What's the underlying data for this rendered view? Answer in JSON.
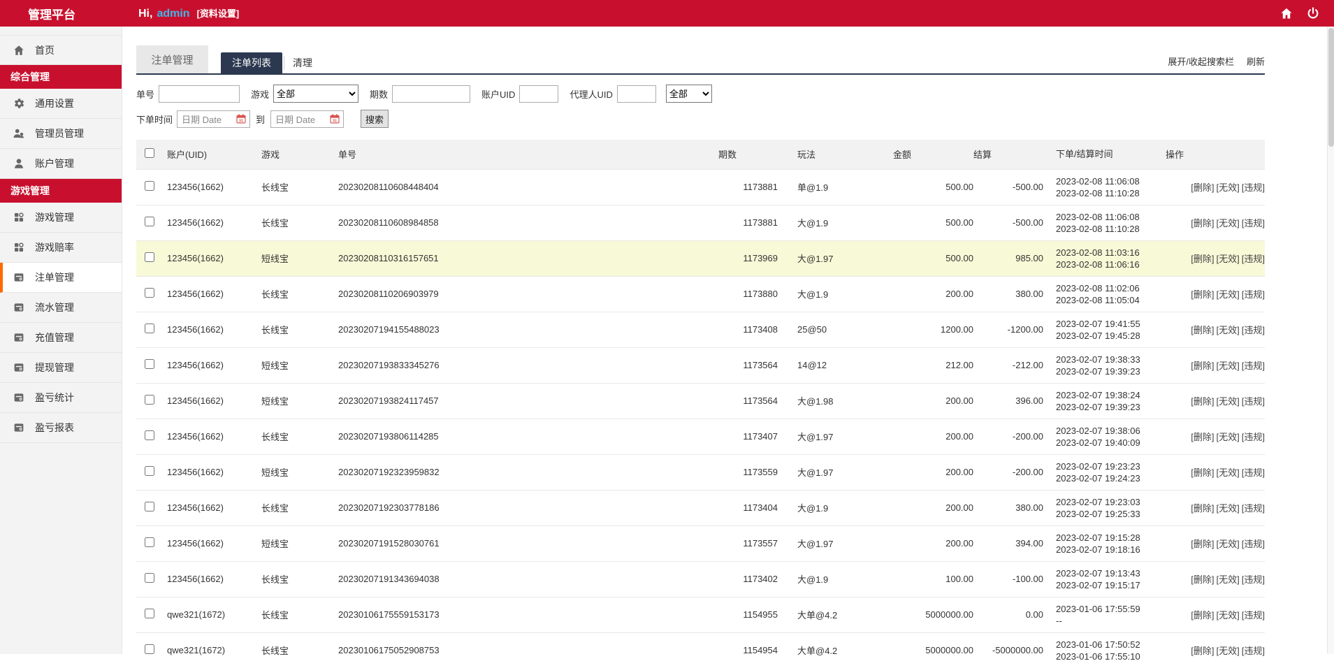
{
  "topbar": {
    "brand": "管理平台",
    "greeting_prefix": "Hi,",
    "username": "admin",
    "profile_link": "[资料设置]"
  },
  "sidebar": {
    "items": [
      {
        "label": "首页",
        "type": "item",
        "icon": "home-icon"
      },
      {
        "label": "综合管理",
        "type": "section"
      },
      {
        "label": "通用设置",
        "type": "item",
        "icon": "gear-icon"
      },
      {
        "label": "管理员管理",
        "type": "item",
        "icon": "admins-icon"
      },
      {
        "label": "账户管理",
        "type": "item",
        "icon": "user-icon"
      },
      {
        "label": "游戏管理",
        "type": "section"
      },
      {
        "label": "游戏管理",
        "type": "item",
        "icon": "grid-icon"
      },
      {
        "label": "游戏赔率",
        "type": "item",
        "icon": "grid-icon"
      },
      {
        "label": "注单管理",
        "type": "item",
        "icon": "report-icon",
        "active": true
      },
      {
        "label": "流水管理",
        "type": "item",
        "icon": "report-icon"
      },
      {
        "label": "充值管理",
        "type": "item",
        "icon": "report-icon"
      },
      {
        "label": "提现管理",
        "type": "item",
        "icon": "report-icon"
      },
      {
        "label": "盈亏统计",
        "type": "item",
        "icon": "report-icon"
      },
      {
        "label": "盈亏报表",
        "type": "item",
        "icon": "report-icon"
      }
    ]
  },
  "page": {
    "title": "注单管理",
    "tabs": [
      {
        "label": "注单列表",
        "active": true
      },
      {
        "label": "清理",
        "active": false
      }
    ],
    "toolbar": {
      "toggle_search": "展开/收起搜索栏",
      "refresh": "刷新"
    }
  },
  "search": {
    "order_no_label": "单号",
    "game_label": "游戏",
    "game_value": "全部",
    "issue_label": "期数",
    "uid_label": "账户UID",
    "agent_label": "代理人UID",
    "status_value": "全部",
    "time_label": "下单时间",
    "date_placeholder": "日期 Date",
    "to_label": "到",
    "search_button": "搜索"
  },
  "table": {
    "headers": [
      "账户(UID)",
      "游戏",
      "单号",
      "期数",
      "玩法",
      "金额",
      "结算",
      "下单/结算时间",
      "操作"
    ],
    "actions": [
      "[删除]",
      "[无效]",
      "[违规]"
    ],
    "rows": [
      {
        "uid": "123456(1662)",
        "game": "长线宝",
        "order": "20230208110608448404",
        "issue": "1173881",
        "play": "单@1.9",
        "amount": "500.00",
        "settle": "-500.00",
        "time_placed": "2023-02-08 11:06:08",
        "time_settled": "2023-02-08 11:10:28",
        "highlight": false
      },
      {
        "uid": "123456(1662)",
        "game": "长线宝",
        "order": "20230208110608984858",
        "issue": "1173881",
        "play": "大@1.9",
        "amount": "500.00",
        "settle": "-500.00",
        "time_placed": "2023-02-08 11:06:08",
        "time_settled": "2023-02-08 11:10:28",
        "highlight": false
      },
      {
        "uid": "123456(1662)",
        "game": "短线宝",
        "order": "20230208110316157651",
        "issue": "1173969",
        "play": "大@1.97",
        "amount": "500.00",
        "settle": "985.00",
        "time_placed": "2023-02-08 11:03:16",
        "time_settled": "2023-02-08 11:06:16",
        "highlight": true
      },
      {
        "uid": "123456(1662)",
        "game": "长线宝",
        "order": "20230208110206903979",
        "issue": "1173880",
        "play": "大@1.9",
        "amount": "200.00",
        "settle": "380.00",
        "time_placed": "2023-02-08 11:02:06",
        "time_settled": "2023-02-08 11:05:04",
        "highlight": false
      },
      {
        "uid": "123456(1662)",
        "game": "长线宝",
        "order": "20230207194155488023",
        "issue": "1173408",
        "play": "25@50",
        "amount": "1200.00",
        "settle": "-1200.00",
        "time_placed": "2023-02-07 19:41:55",
        "time_settled": "2023-02-07 19:45:28",
        "highlight": false
      },
      {
        "uid": "123456(1662)",
        "game": "短线宝",
        "order": "20230207193833345276",
        "issue": "1173564",
        "play": "14@12",
        "amount": "212.00",
        "settle": "-212.00",
        "time_placed": "2023-02-07 19:38:33",
        "time_settled": "2023-02-07 19:39:23",
        "highlight": false
      },
      {
        "uid": "123456(1662)",
        "game": "短线宝",
        "order": "20230207193824117457",
        "issue": "1173564",
        "play": "大@1.98",
        "amount": "200.00",
        "settle": "396.00",
        "time_placed": "2023-02-07 19:38:24",
        "time_settled": "2023-02-07 19:39:23",
        "highlight": false
      },
      {
        "uid": "123456(1662)",
        "game": "长线宝",
        "order": "20230207193806114285",
        "issue": "1173407",
        "play": "大@1.97",
        "amount": "200.00",
        "settle": "-200.00",
        "time_placed": "2023-02-07 19:38:06",
        "time_settled": "2023-02-07 19:40:09",
        "highlight": false
      },
      {
        "uid": "123456(1662)",
        "game": "短线宝",
        "order": "20230207192323959832",
        "issue": "1173559",
        "play": "大@1.97",
        "amount": "200.00",
        "settle": "-200.00",
        "time_placed": "2023-02-07 19:23:23",
        "time_settled": "2023-02-07 19:24:23",
        "highlight": false
      },
      {
        "uid": "123456(1662)",
        "game": "长线宝",
        "order": "20230207192303778186",
        "issue": "1173404",
        "play": "大@1.9",
        "amount": "200.00",
        "settle": "380.00",
        "time_placed": "2023-02-07 19:23:03",
        "time_settled": "2023-02-07 19:25:33",
        "highlight": false
      },
      {
        "uid": "123456(1662)",
        "game": "短线宝",
        "order": "20230207191528030761",
        "issue": "1173557",
        "play": "大@1.97",
        "amount": "200.00",
        "settle": "394.00",
        "time_placed": "2023-02-07 19:15:28",
        "time_settled": "2023-02-07 19:18:16",
        "highlight": false
      },
      {
        "uid": "123456(1662)",
        "game": "长线宝",
        "order": "20230207191343694038",
        "issue": "1173402",
        "play": "大@1.9",
        "amount": "100.00",
        "settle": "-100.00",
        "time_placed": "2023-02-07 19:13:43",
        "time_settled": "2023-02-07 19:15:17",
        "highlight": false
      },
      {
        "uid": "qwe321(1672)",
        "game": "长线宝",
        "order": "20230106175559153173",
        "issue": "1154955",
        "play": "大单@4.2",
        "amount": "5000000.00",
        "settle": "0.00",
        "time_placed": "2023-01-06 17:55:59",
        "time_settled": "--",
        "highlight": false
      },
      {
        "uid": "qwe321(1672)",
        "game": "长线宝",
        "order": "20230106175052908753",
        "issue": "1154954",
        "play": "大单@4.2",
        "amount": "5000000.00",
        "settle": "-5000000.00",
        "time_placed": "2023-01-06 17:50:52",
        "time_settled": "2023-01-06 17:55:10",
        "highlight": false
      }
    ]
  },
  "colors": {
    "brand_red": "#c8102e",
    "active_tab_navy": "#2b3850",
    "active_item_orange": "#ff6a00",
    "username_blue": "#3db6ea",
    "highlight_row": "#f8f9d7"
  }
}
